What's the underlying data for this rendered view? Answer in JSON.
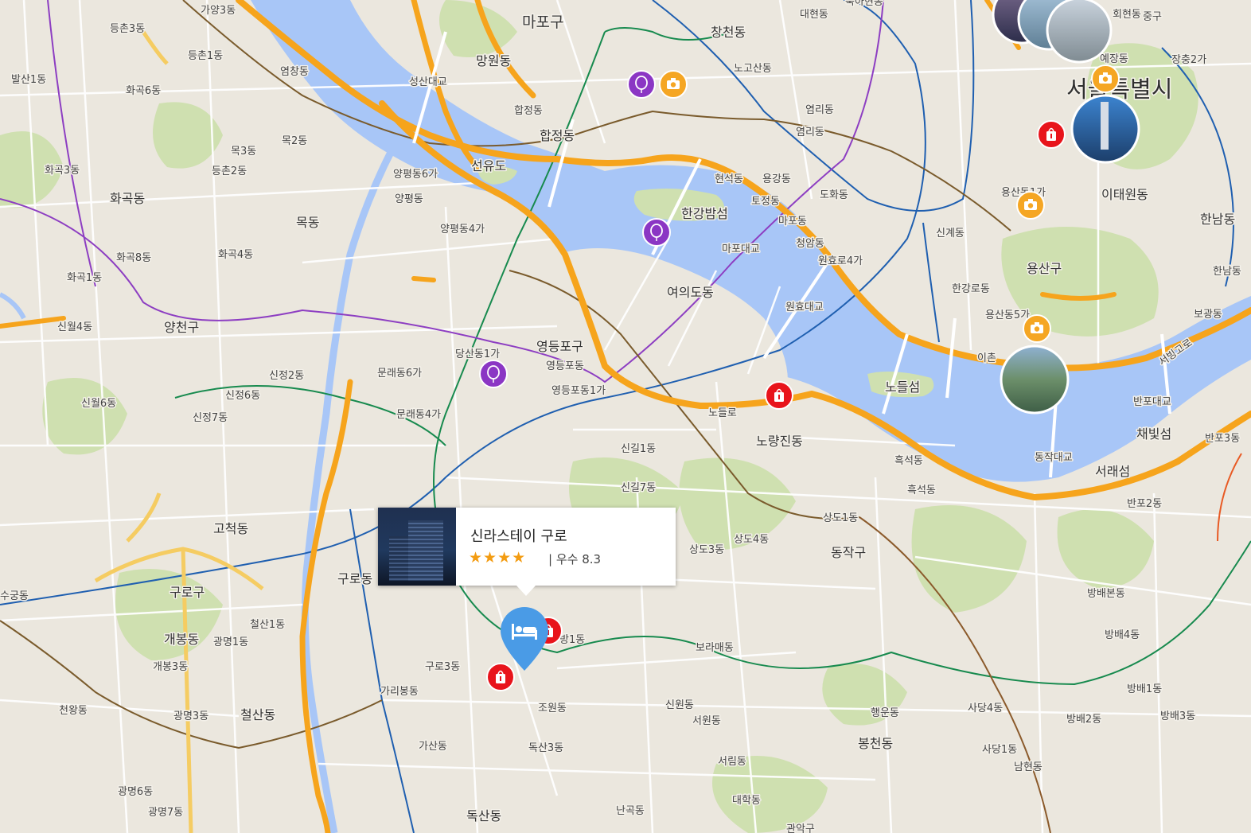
{
  "labels": {
    "mapo_gu": "마포구",
    "mangwon": "망원동",
    "changcheon": "창천동",
    "daehyeon": "대현동",
    "nogosan": "노고산동",
    "yeomni": "염리동",
    "yeomni2": "염리동",
    "hyeonseok": "현석동",
    "yonggang": "용강동",
    "tojeong": "토정동",
    "dohwa": "도화동",
    "mapodong": "마포동",
    "cheongam": "청암동",
    "wonhyoro4ga": "원효로4가",
    "hapjeong": "합정동",
    "hapjeong2": "합정동",
    "seongsan_bridge": "성산대교",
    "seonyudo": "선유도",
    "hangang_bamseom": "한강밤섬",
    "mapo_bridge": "마포대교",
    "wonhyo_bridge": "원효대교",
    "yeouido": "여의도동",
    "yeongdeungpo_gu": "영등포구",
    "yeongdeungpodong": "영등포동",
    "yeongdeungpo1ga": "영등포동1가",
    "dangsan1ga": "당산동1가",
    "mullae6ga": "문래동6가",
    "mullae4ga": "문래동4가",
    "yangpyeong6ga": "양평동6가",
    "yangpyeong": "양평동",
    "yangpyeong4ga": "양평동4가",
    "gayang3": "가양3동",
    "deungchon3": "등촌3동",
    "deungchon1": "등촌1동",
    "yeomchang": "염창동",
    "balsan1": "발산1동",
    "hwagok6": "화곡6동",
    "mok3": "목3동",
    "mok2": "목2동",
    "deungchon2": "등촌2동",
    "hwagok3": "화곡3동",
    "hwagokdong": "화곡동",
    "mokdong": "목동",
    "hwagok8": "화곡8동",
    "hwagok4": "화곡4동",
    "hwagok1": "화곡1동",
    "sinwol4": "신월4동",
    "yangcheon_gu": "양천구",
    "sinjeong2": "신정2동",
    "sinjeong6": "신정6동",
    "sinwol6": "신월6동",
    "sinjeong7": "신정7동",
    "gocheok": "고척동",
    "guro_dong": "구로동",
    "guro_gu": "구로구",
    "sugung": "수궁동",
    "cheolsan1": "철산1동",
    "gaebong": "개봉동",
    "gwangmyeong1": "광명1동",
    "gaebong3": "개봉3동",
    "guro3": "구로3동",
    "garibong": "가리봉동",
    "cheonwang": "천왕동",
    "gwangmyeong3": "광명3동",
    "cheolsan": "철산동",
    "gasan": "가산동",
    "gwangmyeong6": "광명6동",
    "gwangmyeong7": "광명7동",
    "doksan": "독산동",
    "doksan3": "독산3동",
    "singil1": "신길1동",
    "singil7": "신길7동",
    "daebang1": "방1동",
    "sangdo3": "상도3동",
    "sangdo4": "상도4동",
    "sangdo1": "상도1동",
    "dongjak_gu": "동작구",
    "noryangjin": "노량진동",
    "heukseok": "흑석동",
    "heukseok2": "흑석동",
    "nodeul_ro": "노들로",
    "nodeulseom": "노들섬",
    "boramae": "보라매동",
    "sinwon": "신원동",
    "seowon": "서원동",
    "jowon": "조원동",
    "haengun": "행운동",
    "bongcheon": "봉천동",
    "seorim": "서림동",
    "daehak": "대학동",
    "nangok": "난곡동",
    "gwanak_gu": "관악구",
    "sadang4": "사당4동",
    "sadang1": "사당1동",
    "namhyeon": "남현동",
    "bangbae_bon": "방배본동",
    "bangbae4": "방배4동",
    "bangbae1": "방배1동",
    "bangbae2": "방배2동",
    "bangbae3": "방배3동",
    "banpo2": "반포2동",
    "banpo3": "반포3동",
    "seorae": "서래섬",
    "dongjak_bridge": "동작대교",
    "banpo_bridge": "반포대교",
    "chaebit": "채빛섬",
    "seobinggo": "서빙고로",
    "ichon": "이촌",
    "yongsan5ga": "용산동5가",
    "hangangro": "한강로동",
    "singye": "신계동",
    "yongsan_gu": "용산구",
    "yongsan1ga": "용산동1가",
    "itaewon": "이태원동",
    "hannam": "한남동",
    "hannam2": "한남동",
    "bogwang": "보광동",
    "seoul_city": "서울특별시",
    "hoehyeon": "회현동",
    "junggu": "중구",
    "yejang": "예장동",
    "jangchung2": "장충2가",
    "bugahyeon": "북아현동"
  },
  "popup": {
    "hotel_name": "신라스테이 구로",
    "stars": "★★★★",
    "rating_text": "| 우수 8.3"
  },
  "colors": {
    "river": "#a8c6f7",
    "expressway": "#f6a41c",
    "park": "#c9dca8",
    "pin_hotel": "#4a9be6",
    "pin_shop": "#e8141b",
    "pin_attraction": "#8b36c4",
    "pin_photo": "#f5a623"
  },
  "icons": {
    "hotel": "hotel-bed-icon",
    "shop": "shopping-bag-icon",
    "attraction": "balloon-icon",
    "photo": "camera-icon"
  }
}
